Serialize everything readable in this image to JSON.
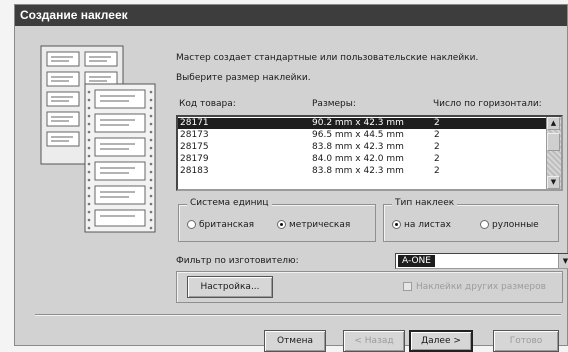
{
  "window": {
    "title": "Создание наклеек"
  },
  "intro": {
    "line1": "Мастер создает стандартные или пользовательские наклейки.",
    "line2": "Выберите размер наклейки."
  },
  "table": {
    "headers": [
      "Код товара:",
      "Размеры:",
      "Число по горизонтали:"
    ],
    "rows": [
      {
        "code": "28171",
        "size": "90.2 mm x 42.3 mm",
        "across": "2",
        "selected": true
      },
      {
        "code": "28173",
        "size": "96.5 mm x 44.5 mm",
        "across": "2",
        "selected": false
      },
      {
        "code": "28175",
        "size": "83.8 mm x 42.3 mm",
        "across": "2",
        "selected": false
      },
      {
        "code": "28179",
        "size": "84.0 mm x 42.0 mm",
        "across": "2",
        "selected": false
      },
      {
        "code": "28183",
        "size": "83.8 mm x 42.3 mm",
        "across": "2",
        "selected": false
      }
    ]
  },
  "units": {
    "legend": "Система единиц",
    "options": [
      {
        "label": "британская",
        "checked": false
      },
      {
        "label": "метрическая",
        "checked": true
      }
    ]
  },
  "label_type": {
    "legend": "Тип наклеек",
    "options": [
      {
        "label": "на листах",
        "checked": true
      },
      {
        "label": "рулонные",
        "checked": false
      }
    ]
  },
  "filter": {
    "label": "Фильтр по изготовителю:",
    "value": "A-ONE"
  },
  "customize_button": "Настройка...",
  "custom_sizes_checkbox": {
    "label": "Наклейки других размеров",
    "checked": false,
    "enabled": false
  },
  "buttons": {
    "cancel": "Отмена",
    "back": "< Назад",
    "next": "Далее >",
    "finish": "Готово"
  },
  "colors": {
    "titlebar": "#3d3d3d",
    "dialog": "#d2d2d2",
    "selection": "#1e1e1e"
  }
}
